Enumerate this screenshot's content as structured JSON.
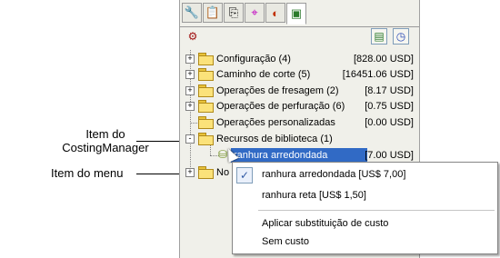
{
  "callouts": {
    "item_label_line1": "Item do",
    "item_label_line2": "CostingManager",
    "menu_label": "Item do menu"
  },
  "tabs": [
    {
      "name": "feature-manager-tab",
      "glyph": "🔧"
    },
    {
      "name": "property-manager-tab",
      "glyph": "📋"
    },
    {
      "name": "configuration-manager-tab",
      "glyph": "⎘"
    },
    {
      "name": "dimxpert-manager-tab",
      "glyph": "⌖"
    },
    {
      "name": "display-manager-tab",
      "glyph": "◐"
    },
    {
      "name": "costing-manager-tab",
      "glyph": "▣"
    }
  ],
  "tree": {
    "rows": [
      {
        "label": "Configuração (4)",
        "cost": "[828.00 USD]",
        "expander": "+"
      },
      {
        "label": "Caminho de corte (5)",
        "cost": "[16451.06 USD]",
        "expander": "+"
      },
      {
        "label": "Operações de fresagem (2)",
        "cost": "[8.17 USD]",
        "expander": "+"
      },
      {
        "label": "Operações de perfuração (6)",
        "cost": "[0.75 USD]",
        "expander": "+"
      },
      {
        "label": "Operações personalizadas",
        "cost": "[0.00 USD]",
        "expander": ""
      },
      {
        "label": "Recursos de biblioteca (1)",
        "cost": "",
        "expander": "-"
      },
      {
        "label": "ranhura arredondada",
        "cost": "[7.00 USD]",
        "expander": ""
      },
      {
        "label": "No",
        "cost": "",
        "expander": "+"
      }
    ]
  },
  "menu": {
    "items": [
      "ranhura arredondada [US$ 7,00]",
      "ranhura reta [US$ 1,50]",
      "Aplicar substituição de custo",
      "Sem custo"
    ],
    "check_glyph": "✓"
  },
  "colors": {
    "selection": "#316ac5",
    "folder": "#fbe27a"
  }
}
